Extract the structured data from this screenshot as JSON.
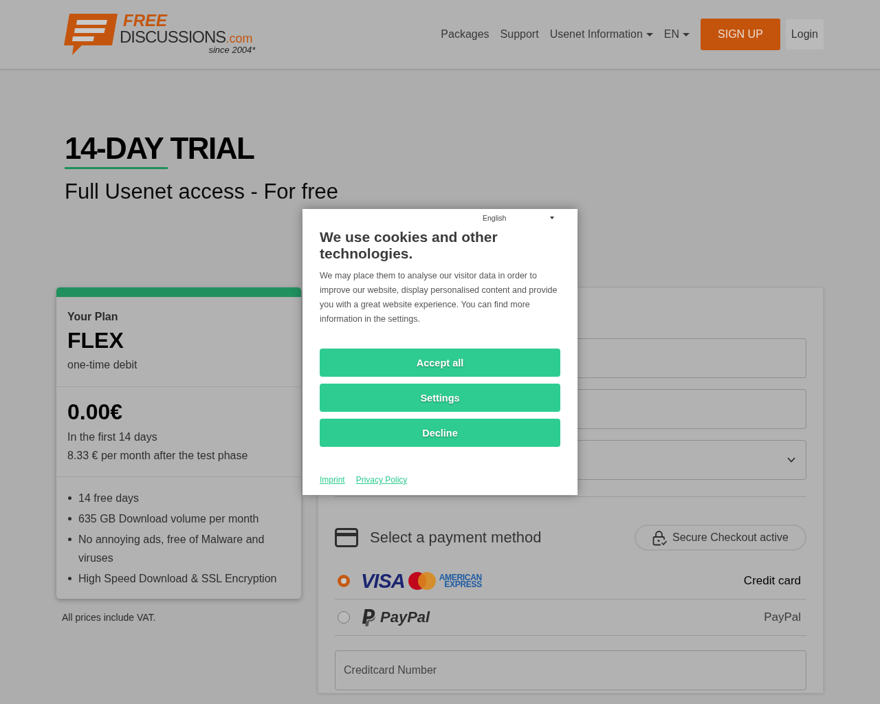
{
  "header": {
    "logo": {
      "word": "FREE",
      "name": "DISCUSSIONS",
      "suffix": ".com",
      "tagline": "since 2004*"
    },
    "nav": [
      {
        "label": "Packages",
        "kind": "link"
      },
      {
        "label": "Support",
        "kind": "link"
      },
      {
        "label": "Usenet Information",
        "kind": "dropdown"
      },
      {
        "label": "EN",
        "kind": "dropdown"
      }
    ],
    "buttons": [
      {
        "label": "SIGN UP",
        "kind": "primary"
      },
      {
        "label": "Login",
        "kind": "secondary"
      }
    ]
  },
  "hero": {
    "title": "14-DAY TRIAL",
    "subtitle": "Full Usenet access - For free"
  },
  "plan_card": {
    "label": "Your Plan",
    "plan": "FLEX",
    "billing": "one-time debit",
    "price": "0.00€",
    "price_notes": [
      "In the first 14 days",
      "8.33 € per month after the test phase"
    ],
    "features": [
      "14 free days",
      "635 GB Download volume per month",
      "No annoying ads, free of Malware and viruses",
      "High Speed Download & SSL Encryption"
    ]
  },
  "vat_note": "All prices include VAT.",
  "checkout": {
    "fields": [
      {
        "kind": "input"
      },
      {
        "kind": "input"
      },
      {
        "kind": "select"
      }
    ],
    "payment": {
      "title": "Select a payment method",
      "badge": "Secure Checkout active",
      "methods": [
        {
          "label": "Credit card",
          "selected": true,
          "brands": [
            {
              "kind": "visa",
              "text": "VISA"
            },
            {
              "kind": "mastercard"
            },
            {
              "kind": "amex",
              "text": "AMERICAN EXPRESS"
            }
          ]
        },
        {
          "label": "PayPal",
          "selected": false,
          "brands": [
            {
              "kind": "paypal",
              "text": "PayPal"
            }
          ]
        }
      ]
    },
    "card_number": {
      "placeholder": "Creditcard Number"
    }
  },
  "cookie_dialog": {
    "language": "English",
    "title": "We use cookies and other technologies.",
    "text": "We may place them to analyse our visitor data in order to improve our website, display personalised content and provide you with a great website experience. You can find more information in the settings.",
    "buttons": [
      "Accept all",
      "Settings",
      "Decline"
    ],
    "links": [
      "Imprint",
      "Privacy Policy"
    ]
  }
}
